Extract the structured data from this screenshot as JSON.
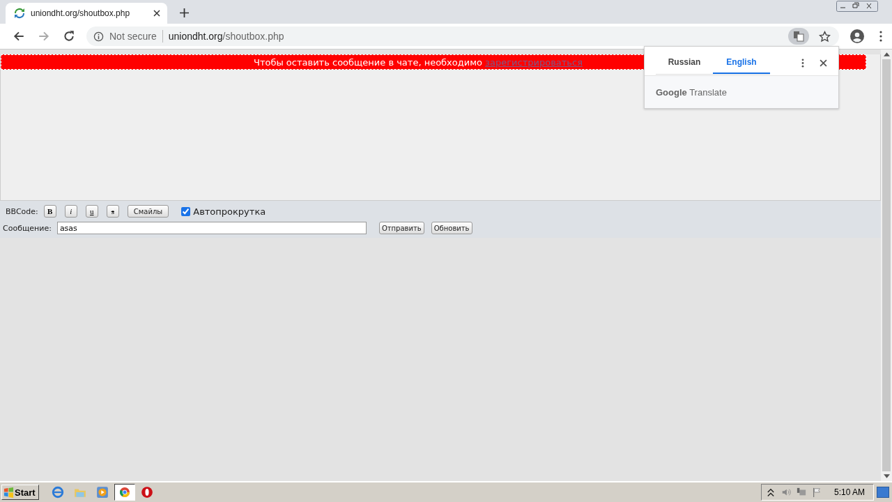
{
  "browser": {
    "tab_title": "uniondht.org/shoutbox.php",
    "security": "Not secure",
    "url_host": "uniondht.org",
    "url_path": "/shoutbox.php"
  },
  "banner": {
    "text": "Чтобы оставить сообщение в чате, необходимо",
    "link": "зарегистрироваться"
  },
  "translate_popup": {
    "tabs": [
      {
        "label": "Russian",
        "selected": false
      },
      {
        "label": "English",
        "selected": true
      }
    ],
    "brand": "Google",
    "product": "Translate"
  },
  "bbcode": {
    "label": "BBCode:",
    "buttons": [
      {
        "label": "B",
        "kind": "bold"
      },
      {
        "label": "i",
        "kind": "italic"
      },
      {
        "label": "u",
        "kind": "underline"
      },
      {
        "label": "s",
        "kind": "strike"
      }
    ],
    "smileys": "Смайлы",
    "autoscroll": {
      "label": "Автопрокрутка",
      "checked": true
    }
  },
  "message": {
    "label": "Сообщение:",
    "value": "asas",
    "buttons": [
      "Отправить",
      "Обновить"
    ]
  },
  "taskbar": {
    "start": "Start",
    "clock": "5:10 AM"
  }
}
